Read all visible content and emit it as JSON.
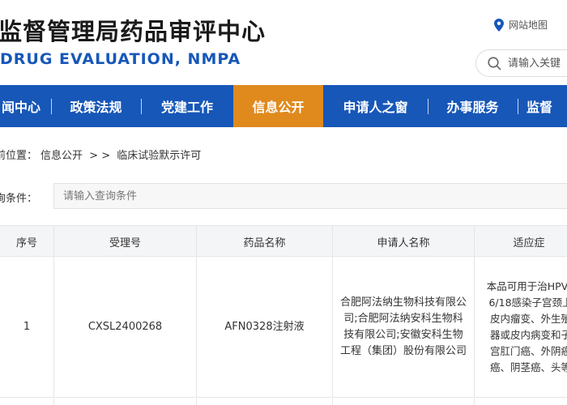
{
  "header": {
    "title_cn": "监督管理局药品审评中心",
    "title_en": "DRUG EVALUATION, NMPA",
    "sitemap": "网站地图",
    "search_placeholder": "请输入关键"
  },
  "nav": {
    "items": [
      {
        "label": "闻中心"
      },
      {
        "label": "政策法规"
      },
      {
        "label": "党建工作"
      },
      {
        "label": "信息公开",
        "active": true
      },
      {
        "label": "申请人之窗"
      },
      {
        "label": "办事服务"
      },
      {
        "label": "监督"
      }
    ]
  },
  "breadcrumb": {
    "prefix": "前位置：",
    "level1": "信息公开",
    "sep": "> >",
    "level2": "临床试验默示许可"
  },
  "query": {
    "label": "询条件：",
    "placeholder": "请输入查询条件"
  },
  "table": {
    "headers": [
      "序号",
      "受理号",
      "药品名称",
      "申请人名称",
      "适应症"
    ],
    "rows": [
      {
        "index": "1",
        "acceptance_no": "CXSL2400268",
        "drug_name": "AFN0328注射液",
        "applicant": "合肥阿法纳生物科技有限公司;合肥阿法纳安科生物科技有限公司;安徽安科生物工程（集团）股份有限公司",
        "indication": "本品可用于治HPV16/18感染子宫颈上皮内瘤变、外生殖器或皮内病变和子宫肛门癌、外阴癌癌、阴茎癌、头等"
      }
    ]
  },
  "colors": {
    "nav_bg": "#1757b8",
    "nav_active": "#e08a1e",
    "title_en": "#1757b8",
    "pin": "#1757b8"
  }
}
